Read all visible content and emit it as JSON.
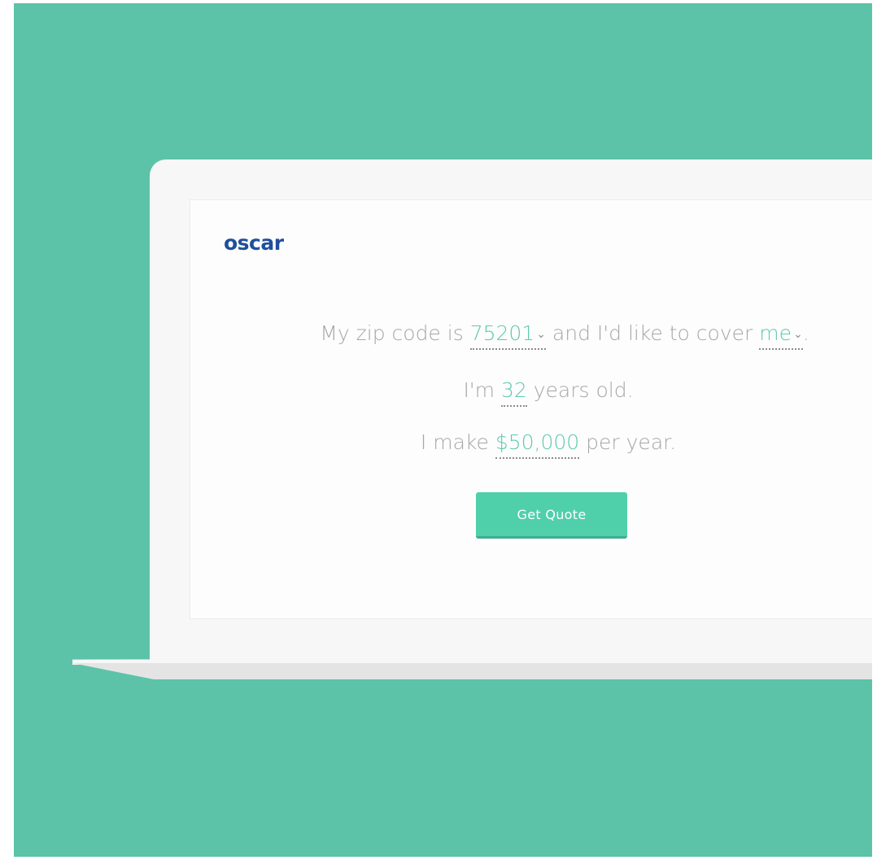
{
  "brand": {
    "logo_text": "oscar",
    "logo_color": "#1f4f9c"
  },
  "colors": {
    "background": "#5cc3a9",
    "accent": "#5ec9ad",
    "button": "#50cfab",
    "text_muted": "#a7a7a7"
  },
  "form": {
    "line1": {
      "prefix": "My zip code is ",
      "zip_value": "75201",
      "middle": " and I'd like to cover ",
      "cover_value": "me",
      "suffix": "."
    },
    "line2": {
      "prefix": "I'm ",
      "age_value": "32",
      "suffix": " years old."
    },
    "line3": {
      "prefix": "I make ",
      "income_value": "$50,000",
      "suffix": " per year."
    },
    "chevron_icon": "chevron-down-icon",
    "chevron_glyph": "⌄"
  },
  "button": {
    "label": "Get Quote"
  }
}
